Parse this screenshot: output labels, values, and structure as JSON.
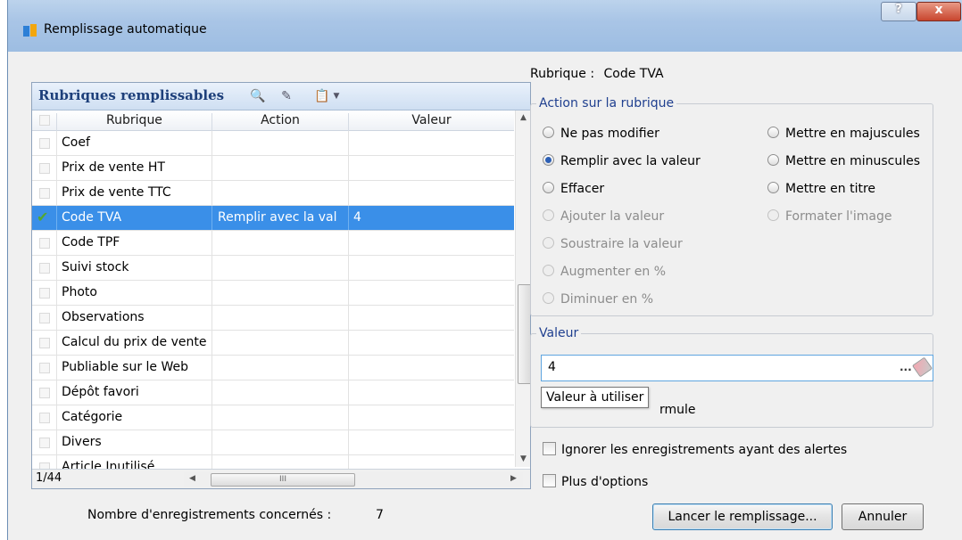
{
  "window": {
    "title": "Remplissage automatique",
    "help": "?",
    "close": "x"
  },
  "grid": {
    "title": "Rubriques remplissables",
    "columns": [
      "Rubrique",
      "Action",
      "Valeur"
    ],
    "rows": [
      {
        "rubrique": "Coef",
        "action": "",
        "valeur": ""
      },
      {
        "rubrique": "Prix de vente HT",
        "action": "",
        "valeur": ""
      },
      {
        "rubrique": "Prix de vente TTC",
        "action": "",
        "valeur": ""
      },
      {
        "rubrique": "Code TVA",
        "action": "Remplir avec la val",
        "valeur": "4"
      },
      {
        "rubrique": "Code TPF",
        "action": "",
        "valeur": ""
      },
      {
        "rubrique": "Suivi stock",
        "action": "",
        "valeur": ""
      },
      {
        "rubrique": "Photo",
        "action": "",
        "valeur": ""
      },
      {
        "rubrique": "Observations",
        "action": "",
        "valeur": ""
      },
      {
        "rubrique": "Calcul du prix de vente",
        "action": "",
        "valeur": ""
      },
      {
        "rubrique": "Publiable sur le Web",
        "action": "",
        "valeur": ""
      },
      {
        "rubrique": "Dépôt favori",
        "action": "",
        "valeur": ""
      },
      {
        "rubrique": "Catégorie",
        "action": "",
        "valeur": ""
      },
      {
        "rubrique": "Divers",
        "action": "",
        "valeur": ""
      },
      {
        "rubrique": "Article Inutilisé",
        "action": "",
        "valeur": ""
      }
    ],
    "selected_index": 3,
    "footer_count": "1/44",
    "hscroll_grip": "III"
  },
  "rubrique": {
    "label": "Rubrique :",
    "value": "Code TVA"
  },
  "action_group": {
    "legend": "Action sur la rubrique",
    "left": [
      {
        "text": "Ne pas modifier",
        "state": "normal"
      },
      {
        "text": "Remplir avec la valeur",
        "state": "checked"
      },
      {
        "text": "Effacer",
        "state": "normal"
      },
      {
        "text": "Ajouter la valeur",
        "state": "disabled"
      },
      {
        "text": "Soustraire la valeur",
        "state": "disabled"
      },
      {
        "text": "Augmenter en %",
        "state": "disabled"
      },
      {
        "text": "Diminuer en %",
        "state": "disabled"
      }
    ],
    "right": [
      {
        "text": "Mettre en majuscules",
        "state": "normal"
      },
      {
        "text": "Mettre en minuscules",
        "state": "normal"
      },
      {
        "text": "Mettre en titre",
        "state": "normal"
      },
      {
        "text": "Formater l'image",
        "state": "disabled"
      }
    ]
  },
  "valeur_group": {
    "legend": "Valeur",
    "input_value": "4",
    "tooltip": "Valeur à utiliser",
    "hidden_text": "rmule",
    "dots_label": "..."
  },
  "options": {
    "ignore_alerts": "Ignorer les enregistrements ayant des alertes",
    "more_options": "Plus d'options"
  },
  "bottom": {
    "count_label": "Nombre d'enregistrements concernés :",
    "count_value": "7",
    "launch_button": "Lancer le remplissage...",
    "cancel_button": "Annuler"
  },
  "colors": {
    "selection": "#3a8fe8",
    "legend": "#1f3f8f",
    "title_bar": "#a9c5e6"
  }
}
